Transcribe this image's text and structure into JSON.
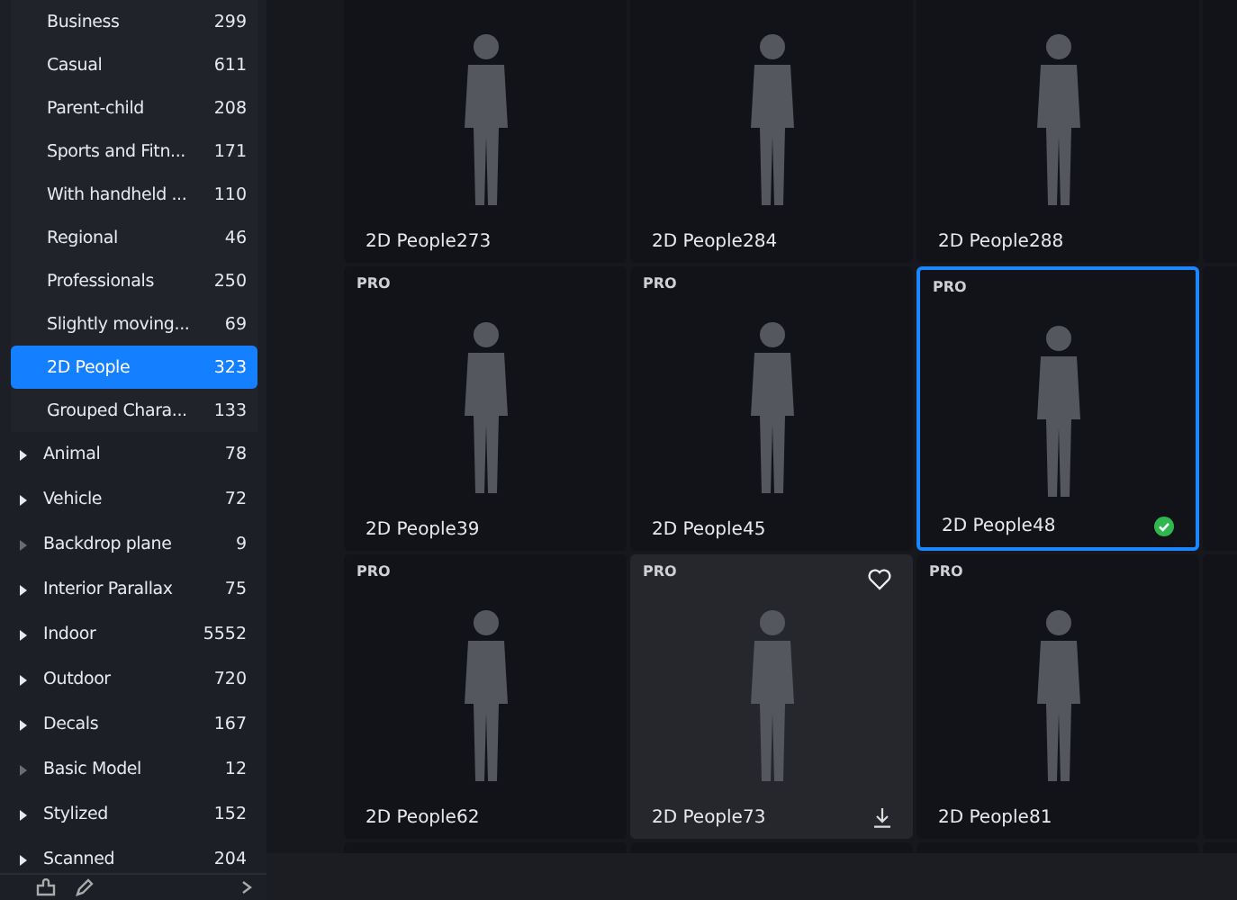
{
  "sidebar": {
    "subitems": [
      {
        "label": "Business",
        "count": "299",
        "selected": false
      },
      {
        "label": "Casual",
        "count": "611",
        "selected": false
      },
      {
        "label": "Parent-child",
        "count": "208",
        "selected": false
      },
      {
        "label": "Sports and Fitn...",
        "count": "171",
        "selected": false
      },
      {
        "label": "With handheld ...",
        "count": "110",
        "selected": false
      },
      {
        "label": "Regional",
        "count": "46",
        "selected": false
      },
      {
        "label": "Professionals",
        "count": "250",
        "selected": false
      },
      {
        "label": "Slightly moving...",
        "count": "69",
        "selected": false
      },
      {
        "label": "2D People",
        "count": "323",
        "selected": true
      },
      {
        "label": "Grouped Chara...",
        "count": "133",
        "selected": false
      }
    ],
    "items": [
      {
        "label": "Animal",
        "count": "78",
        "expandable": true
      },
      {
        "label": "Vehicle",
        "count": "72",
        "expandable": true
      },
      {
        "label": "Backdrop plane",
        "count": "9",
        "expandable": false
      },
      {
        "label": "Interior Parallax",
        "count": "75",
        "expandable": true
      },
      {
        "label": "Indoor",
        "count": "5552",
        "expandable": true
      },
      {
        "label": "Outdoor",
        "count": "720",
        "expandable": true
      },
      {
        "label": "Decals",
        "count": "167",
        "expandable": true
      },
      {
        "label": "Basic Model",
        "count": "12",
        "expandable": false
      },
      {
        "label": "Stylized",
        "count": "152",
        "expandable": true
      },
      {
        "label": "Scanned",
        "count": "204",
        "expandable": true
      }
    ]
  },
  "grid": {
    "cards": [
      {
        "name": "2D People273",
        "selected": false,
        "hovered": false
      },
      {
        "name": "2D People284",
        "selected": false,
        "hovered": false
      },
      {
        "name": "2D People288",
        "selected": false,
        "hovered": false
      },
      {
        "name": "2D People39",
        "badge": "PRO",
        "selected": false,
        "hovered": false
      },
      {
        "name": "2D People45",
        "badge": "PRO",
        "selected": false,
        "hovered": false
      },
      {
        "name": "2D People48",
        "badge": "PRO",
        "selected": true,
        "hovered": false
      },
      {
        "name": "2D People62",
        "badge": "PRO",
        "selected": false,
        "hovered": false
      },
      {
        "name": "2D People73",
        "badge": "PRO",
        "selected": false,
        "hovered": true
      },
      {
        "name": "2D People81",
        "badge": "PRO",
        "selected": false,
        "hovered": false
      }
    ]
  }
}
